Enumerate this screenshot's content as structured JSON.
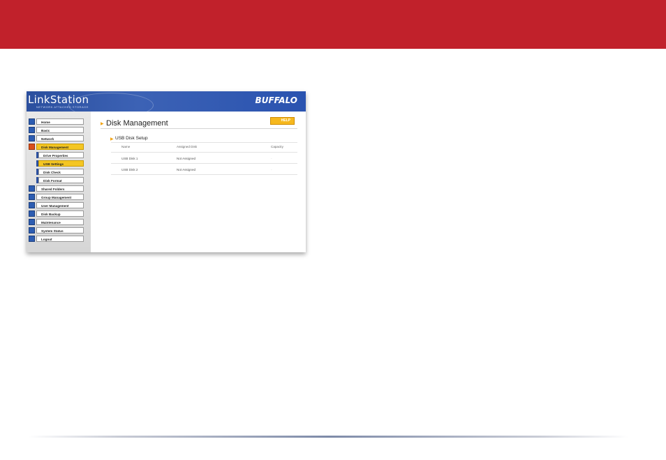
{
  "shot": {
    "logo": "LinkStation",
    "tagline": "NETWORK ATTACHED STORAGE",
    "brand": "BUFFALO"
  },
  "sidebar": {
    "items": [
      {
        "label": "Home",
        "active": false,
        "sub": false
      },
      {
        "label": "Basic",
        "active": false,
        "sub": false
      },
      {
        "label": "Network",
        "active": false,
        "sub": false
      },
      {
        "label": "Disk Management",
        "active": true,
        "sub": false
      },
      {
        "label": "Drive Properties",
        "active": false,
        "sub": true
      },
      {
        "label": "USB Settings",
        "active": true,
        "sub": true
      },
      {
        "label": "Disk Check",
        "active": false,
        "sub": true
      },
      {
        "label": "Disk Format",
        "active": false,
        "sub": true
      },
      {
        "label": "Shared Folders",
        "active": false,
        "sub": false
      },
      {
        "label": "Group Management",
        "active": false,
        "sub": false
      },
      {
        "label": "User Management",
        "active": false,
        "sub": false
      },
      {
        "label": "Disk Backup",
        "active": false,
        "sub": false
      },
      {
        "label": "Maintenance",
        "active": false,
        "sub": false
      },
      {
        "label": "System Status",
        "active": false,
        "sub": false
      },
      {
        "label": "Logout",
        "active": false,
        "sub": false
      }
    ]
  },
  "main": {
    "title": "Disk Management",
    "help_label": "HELP",
    "section": "USB Disk Setup",
    "columns": [
      "Name",
      "Assigned Disk",
      "Capacity"
    ],
    "rows": [
      {
        "name": "USB Disk 1",
        "assigned": "Not Assigned",
        "capacity": "-"
      },
      {
        "name": "USB Disk 2",
        "assigned": "Not Assigned",
        "capacity": "-"
      }
    ]
  },
  "colors": {
    "band": "#c1212b",
    "header_blue": "#2b4f9e",
    "active_yellow": "#f4c623",
    "help_orange": "#f6b81e"
  },
  "icons": {
    "menu": "menu-square-icon",
    "bullet": "arrow-bullet-icon"
  }
}
